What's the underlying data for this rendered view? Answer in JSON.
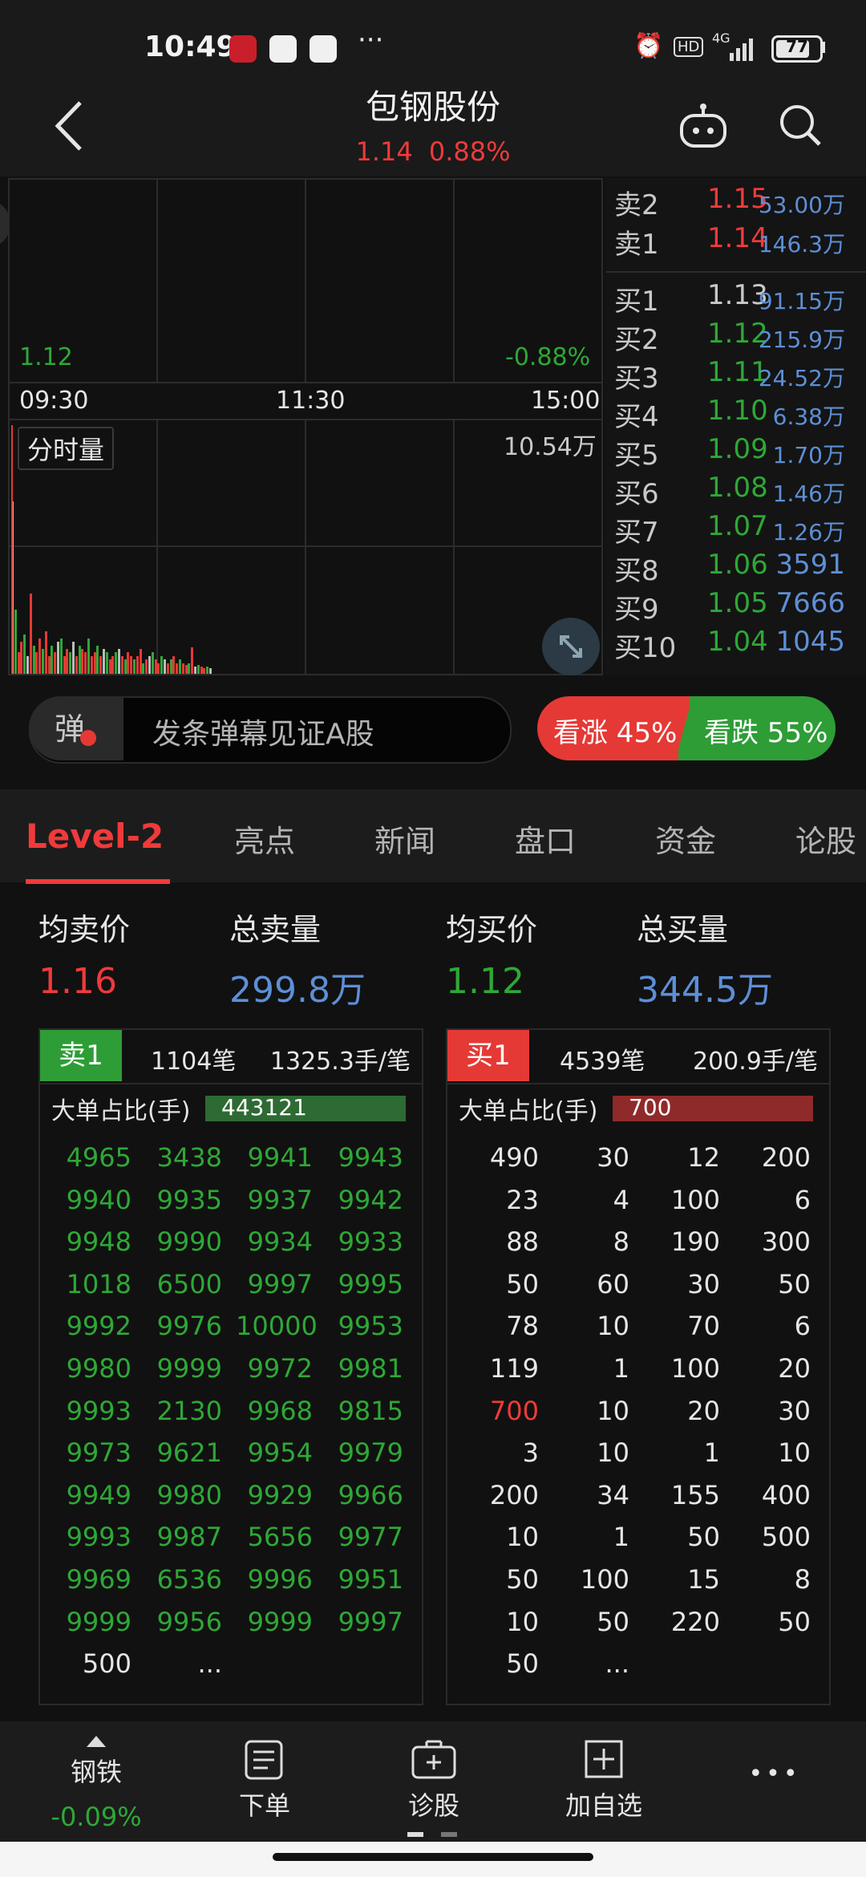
{
  "status_bar": {
    "time": "10:49",
    "more": "···",
    "hd": "HD",
    "net": "4G",
    "battery": "77"
  },
  "nav": {
    "title": "包钢股份",
    "price": "1.14",
    "change_pct": "0.88%"
  },
  "chart": {
    "low_price": "1.12",
    "low_pct": "-0.88%",
    "time_labels": [
      "09:30",
      "11:30",
      "15:00"
    ],
    "volume_label": "分时量",
    "volume_max": "10.54万",
    "volume_bars": [
      0.98,
      0.36,
      0.12,
      0.18,
      0.22,
      0.1,
      0.45,
      0.16,
      0.12,
      0.2,
      0.14,
      0.24,
      0.1,
      0.16,
      0.12,
      0.18,
      0.2,
      0.1,
      0.14,
      0.12,
      0.18,
      0.1,
      0.16,
      0.14,
      0.12,
      0.2,
      0.1,
      0.12,
      0.16,
      0.1,
      0.14,
      0.12,
      0.08,
      0.1,
      0.12,
      0.14,
      0.1,
      0.08,
      0.12,
      0.1,
      0.08,
      0.1,
      0.14,
      0.06,
      0.08,
      0.1,
      0.12,
      0.08,
      0.06,
      0.1,
      0.08,
      0.06,
      0.08,
      0.1,
      0.06,
      0.08,
      0.06,
      0.05,
      0.06,
      0.15,
      0.04,
      0.05,
      0.04,
      0.03,
      0.04,
      0.03
    ]
  },
  "order_book": {
    "asks": [
      {
        "label": "卖2",
        "price": "1.15",
        "volume": "53.00万"
      },
      {
        "label": "卖1",
        "price": "1.14",
        "volume": "146.3万"
      }
    ],
    "bids": [
      {
        "label": "买1",
        "price": "1.13",
        "volume": "91.15万"
      },
      {
        "label": "买2",
        "price": "1.12",
        "volume": "215.9万"
      },
      {
        "label": "买3",
        "price": "1.11",
        "volume": "24.52万"
      },
      {
        "label": "买4",
        "price": "1.10",
        "volume": "6.38万"
      },
      {
        "label": "买5",
        "price": "1.09",
        "volume": "1.70万"
      },
      {
        "label": "买6",
        "price": "1.08",
        "volume": "1.46万"
      },
      {
        "label": "买7",
        "price": "1.07",
        "volume": "1.26万"
      },
      {
        "label": "买8",
        "price": "1.06",
        "volume": "3591"
      },
      {
        "label": "买9",
        "price": "1.05",
        "volume": "7666"
      },
      {
        "label": "买10",
        "price": "1.04",
        "volume": "1045"
      }
    ]
  },
  "danmaku": {
    "icon_label": "弹",
    "placeholder": "发条弹幕见证A股"
  },
  "sentiment": {
    "up": "看涨 45%",
    "down": "看跌 55%",
    "up_pct": 45
  },
  "tabs": [
    "Level-2",
    "亮点",
    "新闻",
    "盘口",
    "资金",
    "论股"
  ],
  "summary": {
    "avg_sell_label": "均卖价",
    "avg_sell": "1.16",
    "total_sell_label": "总卖量",
    "total_sell": "299.8万",
    "avg_buy_label": "均买价",
    "avg_buy": "1.12",
    "total_buy_label": "总买量",
    "total_buy": "344.5万"
  },
  "sell_queue": {
    "badge": "卖1",
    "count": "1104笔",
    "avg": "1325.3手/笔",
    "big_label": "大单占比(手)",
    "big_value": "443121",
    "rows": [
      [
        "4965",
        "3438",
        "9941",
        "9943"
      ],
      [
        "9940",
        "9935",
        "9937",
        "9942"
      ],
      [
        "9948",
        "9990",
        "9934",
        "9933"
      ],
      [
        "1018",
        "6500",
        "9997",
        "9995"
      ],
      [
        "9992",
        "9976",
        "10000",
        "9953"
      ],
      [
        "9980",
        "9999",
        "9972",
        "9981"
      ],
      [
        "9993",
        "2130",
        "9968",
        "9815"
      ],
      [
        "9973",
        "9621",
        "9954",
        "9979"
      ],
      [
        "9949",
        "9980",
        "9929",
        "9966"
      ],
      [
        "9993",
        "9987",
        "5656",
        "9977"
      ],
      [
        "9969",
        "6536",
        "9996",
        "9951"
      ],
      [
        "9999",
        "9956",
        "9999",
        "9997"
      ],
      [
        "500",
        "..."
      ]
    ]
  },
  "buy_queue": {
    "badge": "买1",
    "count": "4539笔",
    "avg": "200.9手/笔",
    "big_label": "大单占比(手)",
    "big_value": "700",
    "rows": [
      [
        "490",
        "30",
        "12",
        "200"
      ],
      [
        "23",
        "4",
        "100",
        "6"
      ],
      [
        "88",
        "8",
        "190",
        "300"
      ],
      [
        "50",
        "60",
        "30",
        "50"
      ],
      [
        "78",
        "10",
        "70",
        "6"
      ],
      [
        "119",
        "1",
        "100",
        "20"
      ],
      [
        "700",
        "10",
        "20",
        "30"
      ],
      [
        "3",
        "10",
        "1",
        "10"
      ],
      [
        "200",
        "34",
        "155",
        "400"
      ],
      [
        "10",
        "1",
        "50",
        "500"
      ],
      [
        "50",
        "100",
        "15",
        "8"
      ],
      [
        "10",
        "50",
        "220",
        "50"
      ],
      [
        "50",
        "..."
      ]
    ]
  },
  "bottom_bar": {
    "sector": "钢铁",
    "sector_change": "-0.09%",
    "order": "下单",
    "diagnose": "诊股",
    "add_watch": "加自选",
    "more": "•••"
  }
}
